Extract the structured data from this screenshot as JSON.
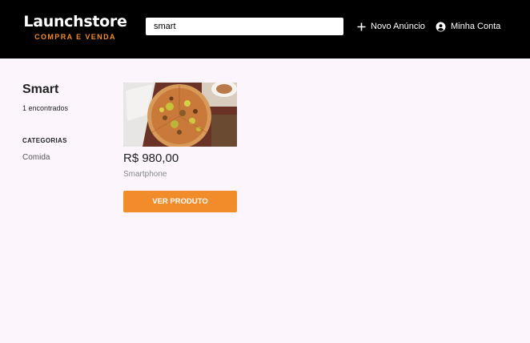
{
  "header": {
    "logo_title": "Launchstore",
    "logo_subtitle": "COMPRA E VENDA",
    "search": {
      "value": "smart",
      "placeholder": "Buscar"
    },
    "nav": {
      "new_ad_label": "Novo Anúncio",
      "account_label": "Minha Conta"
    }
  },
  "sidebar": {
    "search_term": "Smart",
    "results_count": "1 encontrados",
    "categories_title": "CATEGORIAS",
    "categories": [
      "Comida"
    ]
  },
  "products": [
    {
      "price": "R$ 980,00",
      "category": "Smartphone",
      "button_label": "VER PRODUTO",
      "image": "pizza-photo"
    }
  ],
  "colors": {
    "header_bg": "#000000",
    "accent": "#f28c2b",
    "page_bg": "#fcf6fc"
  }
}
